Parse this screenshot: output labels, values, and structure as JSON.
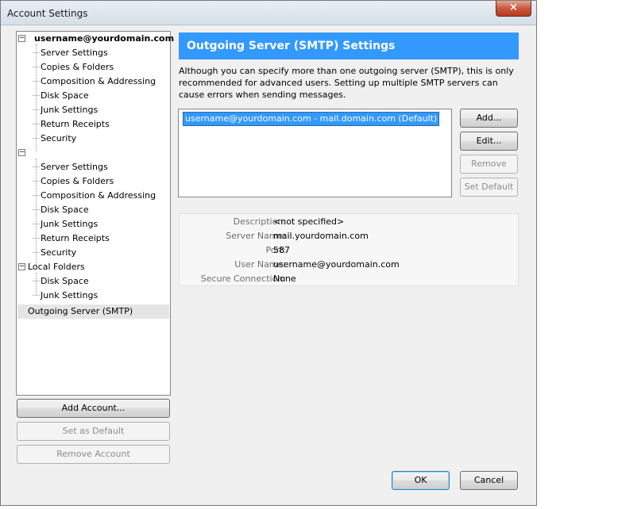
{
  "window": {
    "title": "Account Settings",
    "close_label": "×"
  },
  "tree": {
    "account1": {
      "name": "username@yourdomain.com",
      "items": [
        "Server Settings",
        "Copies & Folders",
        "Composition & Addressing",
        "Disk Space",
        "Junk Settings",
        "Return Receipts",
        "Security"
      ]
    },
    "account2": {
      "name": "",
      "items": [
        "Server Settings",
        "Copies & Folders",
        "Composition & Addressing",
        "Disk Space",
        "Junk Settings",
        "Return Receipts",
        "Security"
      ]
    },
    "local_folders": {
      "name": "Local Folders",
      "items": [
        "Disk Space",
        "Junk Settings"
      ]
    },
    "outgoing": "Outgoing Server (SMTP)",
    "expander_minus": "−"
  },
  "left_buttons": {
    "add_account": "Add Account...",
    "set_default": "Set as Default",
    "remove_account": "Remove Account"
  },
  "main": {
    "header": "Outgoing Server (SMTP) Settings",
    "description": "Although you can specify more than one outgoing server (SMTP), this is only recommended for advanced users. Setting up multiple SMTP servers can cause errors when sending messages.",
    "servers": [
      "username@yourdomain.com - mail.domain.com (Default)"
    ],
    "buttons": {
      "add": "Add...",
      "edit": "Edit...",
      "remove": "Remove",
      "set_default": "Set Default"
    },
    "details": {
      "description_label": "Description:",
      "description_value": "<not specified>",
      "server_label": "Server Name:",
      "server_value": "mail.yourdomain.com",
      "port_label": "Port:",
      "port_value": "587",
      "user_label": "User Name:",
      "user_value": "username@yourdomain.com",
      "secure_label": "Secure Connection:",
      "secure_value": "None"
    }
  },
  "footer": {
    "ok": "OK",
    "cancel": "Cancel"
  }
}
